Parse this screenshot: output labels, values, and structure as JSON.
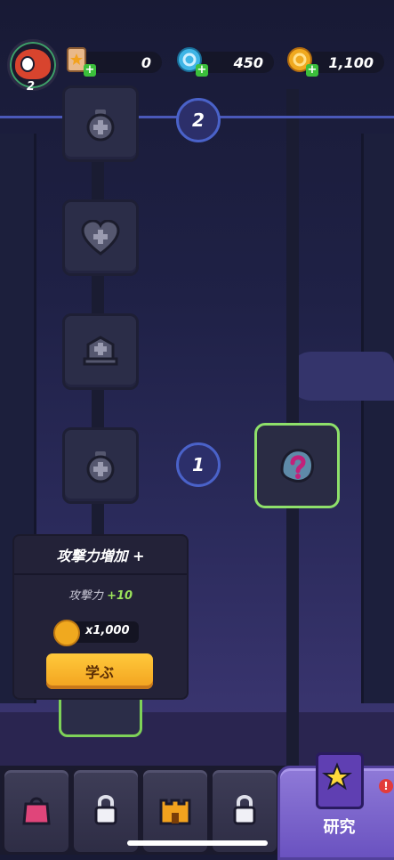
{
  "hud": {
    "player_level": "2",
    "resources": [
      {
        "name": "card-tickets",
        "value": "0",
        "icon": "star-card-icon"
      },
      {
        "name": "blue-gems",
        "value": "450",
        "icon": "blue-gem-icon"
      },
      {
        "name": "gold-coins",
        "value": "1,100",
        "icon": "gold-coin-icon"
      }
    ]
  },
  "tree": {
    "tier_badges": [
      "2",
      "1"
    ],
    "nodes": [
      {
        "icon": "potion-plus-icon",
        "locked": true
      },
      {
        "icon": "heart-plus-icon",
        "locked": true
      },
      {
        "icon": "tombstone-plus-icon",
        "locked": true
      },
      {
        "icon": "potion-plus-icon",
        "locked": true
      },
      {
        "icon": "mystery-icon",
        "locked": false,
        "highlighted": true
      }
    ]
  },
  "popup": {
    "title": "攻撃力増加 +",
    "stat_label": "攻撃力",
    "stat_bonus": "+10",
    "cost": "x1,000",
    "learn_label": "学ぶ"
  },
  "nav": {
    "items": [
      {
        "name": "shop",
        "icon": "shopping-bag-icon"
      },
      {
        "name": "locked-1",
        "icon": "lock-icon"
      },
      {
        "name": "castle",
        "icon": "castle-icon"
      },
      {
        "name": "locked-2",
        "icon": "lock-icon"
      },
      {
        "name": "research",
        "label": "研究",
        "icon": "book-star-icon",
        "notification": "!"
      }
    ]
  },
  "colors": {
    "accent_gold": "#f2a21e",
    "accent_green": "#8ee06a",
    "tier_blue": "#4a62c9",
    "notification_red": "#e33b3b"
  }
}
